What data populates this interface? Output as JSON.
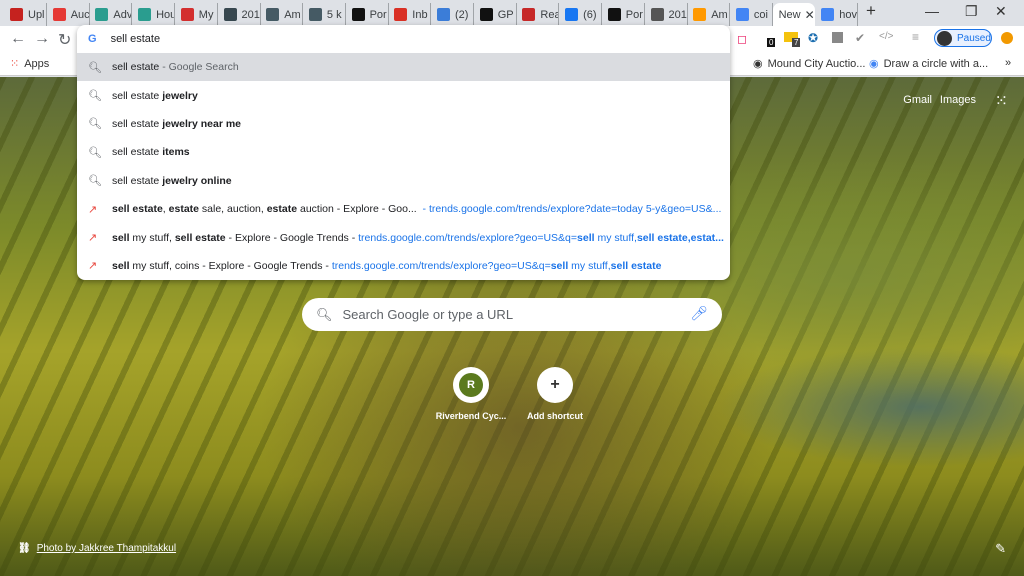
{
  "tabs": [
    {
      "label": "Upl",
      "color": "#c5221f"
    },
    {
      "label": "Auc",
      "color": "#e53935"
    },
    {
      "label": "Adv",
      "color": "#2a9d8f"
    },
    {
      "label": "Hou",
      "color": "#2a9d8f"
    },
    {
      "label": "My",
      "color": "#d32f2f"
    },
    {
      "label": "201",
      "color": "#37474f"
    },
    {
      "label": "Am",
      "color": "#455a64"
    },
    {
      "label": "5 k",
      "color": "#455a64"
    },
    {
      "label": "Por",
      "color": "#111111"
    },
    {
      "label": "Inb",
      "color": "#d93025"
    },
    {
      "label": "(2)",
      "color": "#3b7dd8"
    },
    {
      "label": "GP",
      "color": "#111111"
    },
    {
      "label": "Rea",
      "color": "#c62828"
    },
    {
      "label": "(6)",
      "color": "#1877f2"
    },
    {
      "label": "Por",
      "color": "#111111"
    },
    {
      "label": "201",
      "color": "#555555"
    },
    {
      "label": "Am",
      "color": "#ff9900"
    },
    {
      "label": "coi",
      "color": "#4285f4"
    },
    {
      "label": "New",
      "color": "#ffffff",
      "active": true
    },
    {
      "label": "hov",
      "color": "#4285f4"
    }
  ],
  "window": {
    "new_tab": "+",
    "minimize": "—",
    "restore": "❐",
    "close": "✕"
  },
  "toolbar": {
    "profile_label": "Paused",
    "badge_a": "0",
    "badge_b": "7"
  },
  "bookmarks": {
    "apps": "Apps",
    "items": [
      "Mound City Auctio...",
      "Draw a circle with a..."
    ],
    "more": "»"
  },
  "omnibox": {
    "value": "sell estate",
    "suggestions": [
      {
        "type": "search",
        "selected": true,
        "parts": [
          {
            "t": "sell estate",
            "b": false
          },
          {
            "t": " - Google Search",
            "b": false,
            "dim": true
          }
        ]
      },
      {
        "type": "search",
        "parts": [
          {
            "t": "sell estate ",
            "b": false
          },
          {
            "t": "jewelry",
            "b": true
          }
        ]
      },
      {
        "type": "search",
        "parts": [
          {
            "t": "sell estate ",
            "b": false
          },
          {
            "t": "jewelry near me",
            "b": true
          }
        ]
      },
      {
        "type": "search",
        "parts": [
          {
            "t": "sell estate ",
            "b": false
          },
          {
            "t": "items",
            "b": true
          }
        ]
      },
      {
        "type": "search",
        "parts": [
          {
            "t": "sell estate ",
            "b": false
          },
          {
            "t": "jewelry online",
            "b": true
          }
        ]
      },
      {
        "type": "history",
        "parts": [
          {
            "t": "sell estate",
            "b": true
          },
          {
            "t": ", ",
            "b": false
          },
          {
            "t": "estate",
            "b": true
          },
          {
            "t": " sale, auction, ",
            "b": false
          },
          {
            "t": "estate",
            "b": true
          },
          {
            "t": " auction - Explore - Goo... ",
            "b": false
          },
          {
            "t": " - trends.google.com/trends/explore?date=today 5-y&geo=US&...",
            "b": false,
            "url": true
          }
        ]
      },
      {
        "type": "history",
        "parts": [
          {
            "t": "sell",
            "b": true
          },
          {
            "t": " my stuff, ",
            "b": false
          },
          {
            "t": "sell estate",
            "b": true
          },
          {
            "t": " - Explore - Google Trends - ",
            "b": false
          },
          {
            "t": "trends.google.com/trends/explore?geo=US&q=",
            "b": false,
            "url": true
          },
          {
            "t": "sell",
            "b": true,
            "url": true
          },
          {
            "t": " my stuff,",
            "b": false,
            "url": true
          },
          {
            "t": "sell estate,estat...",
            "b": true,
            "url": true
          }
        ]
      },
      {
        "type": "history",
        "parts": [
          {
            "t": "sell",
            "b": true
          },
          {
            "t": " my stuff, coins - Explore - Google Trends - ",
            "b": false
          },
          {
            "t": "trends.google.com/trends/explore?geo=US&q=",
            "b": false,
            "url": true
          },
          {
            "t": "sell",
            "b": true,
            "url": true
          },
          {
            "t": " my stuff,",
            "b": false,
            "url": true
          },
          {
            "t": "sell estate",
            "b": true,
            "url": true
          }
        ]
      }
    ]
  },
  "ntp": {
    "gmail": "Gmail",
    "images": "Images",
    "search_placeholder": "Search Google or type a URL",
    "shortcuts": [
      {
        "initial": "R",
        "label": "Riverbend Cyc..."
      },
      {
        "initial": "+",
        "label": "Add shortcut"
      }
    ],
    "photo_credit": "Photo by Jakkree Thampitakkul"
  }
}
